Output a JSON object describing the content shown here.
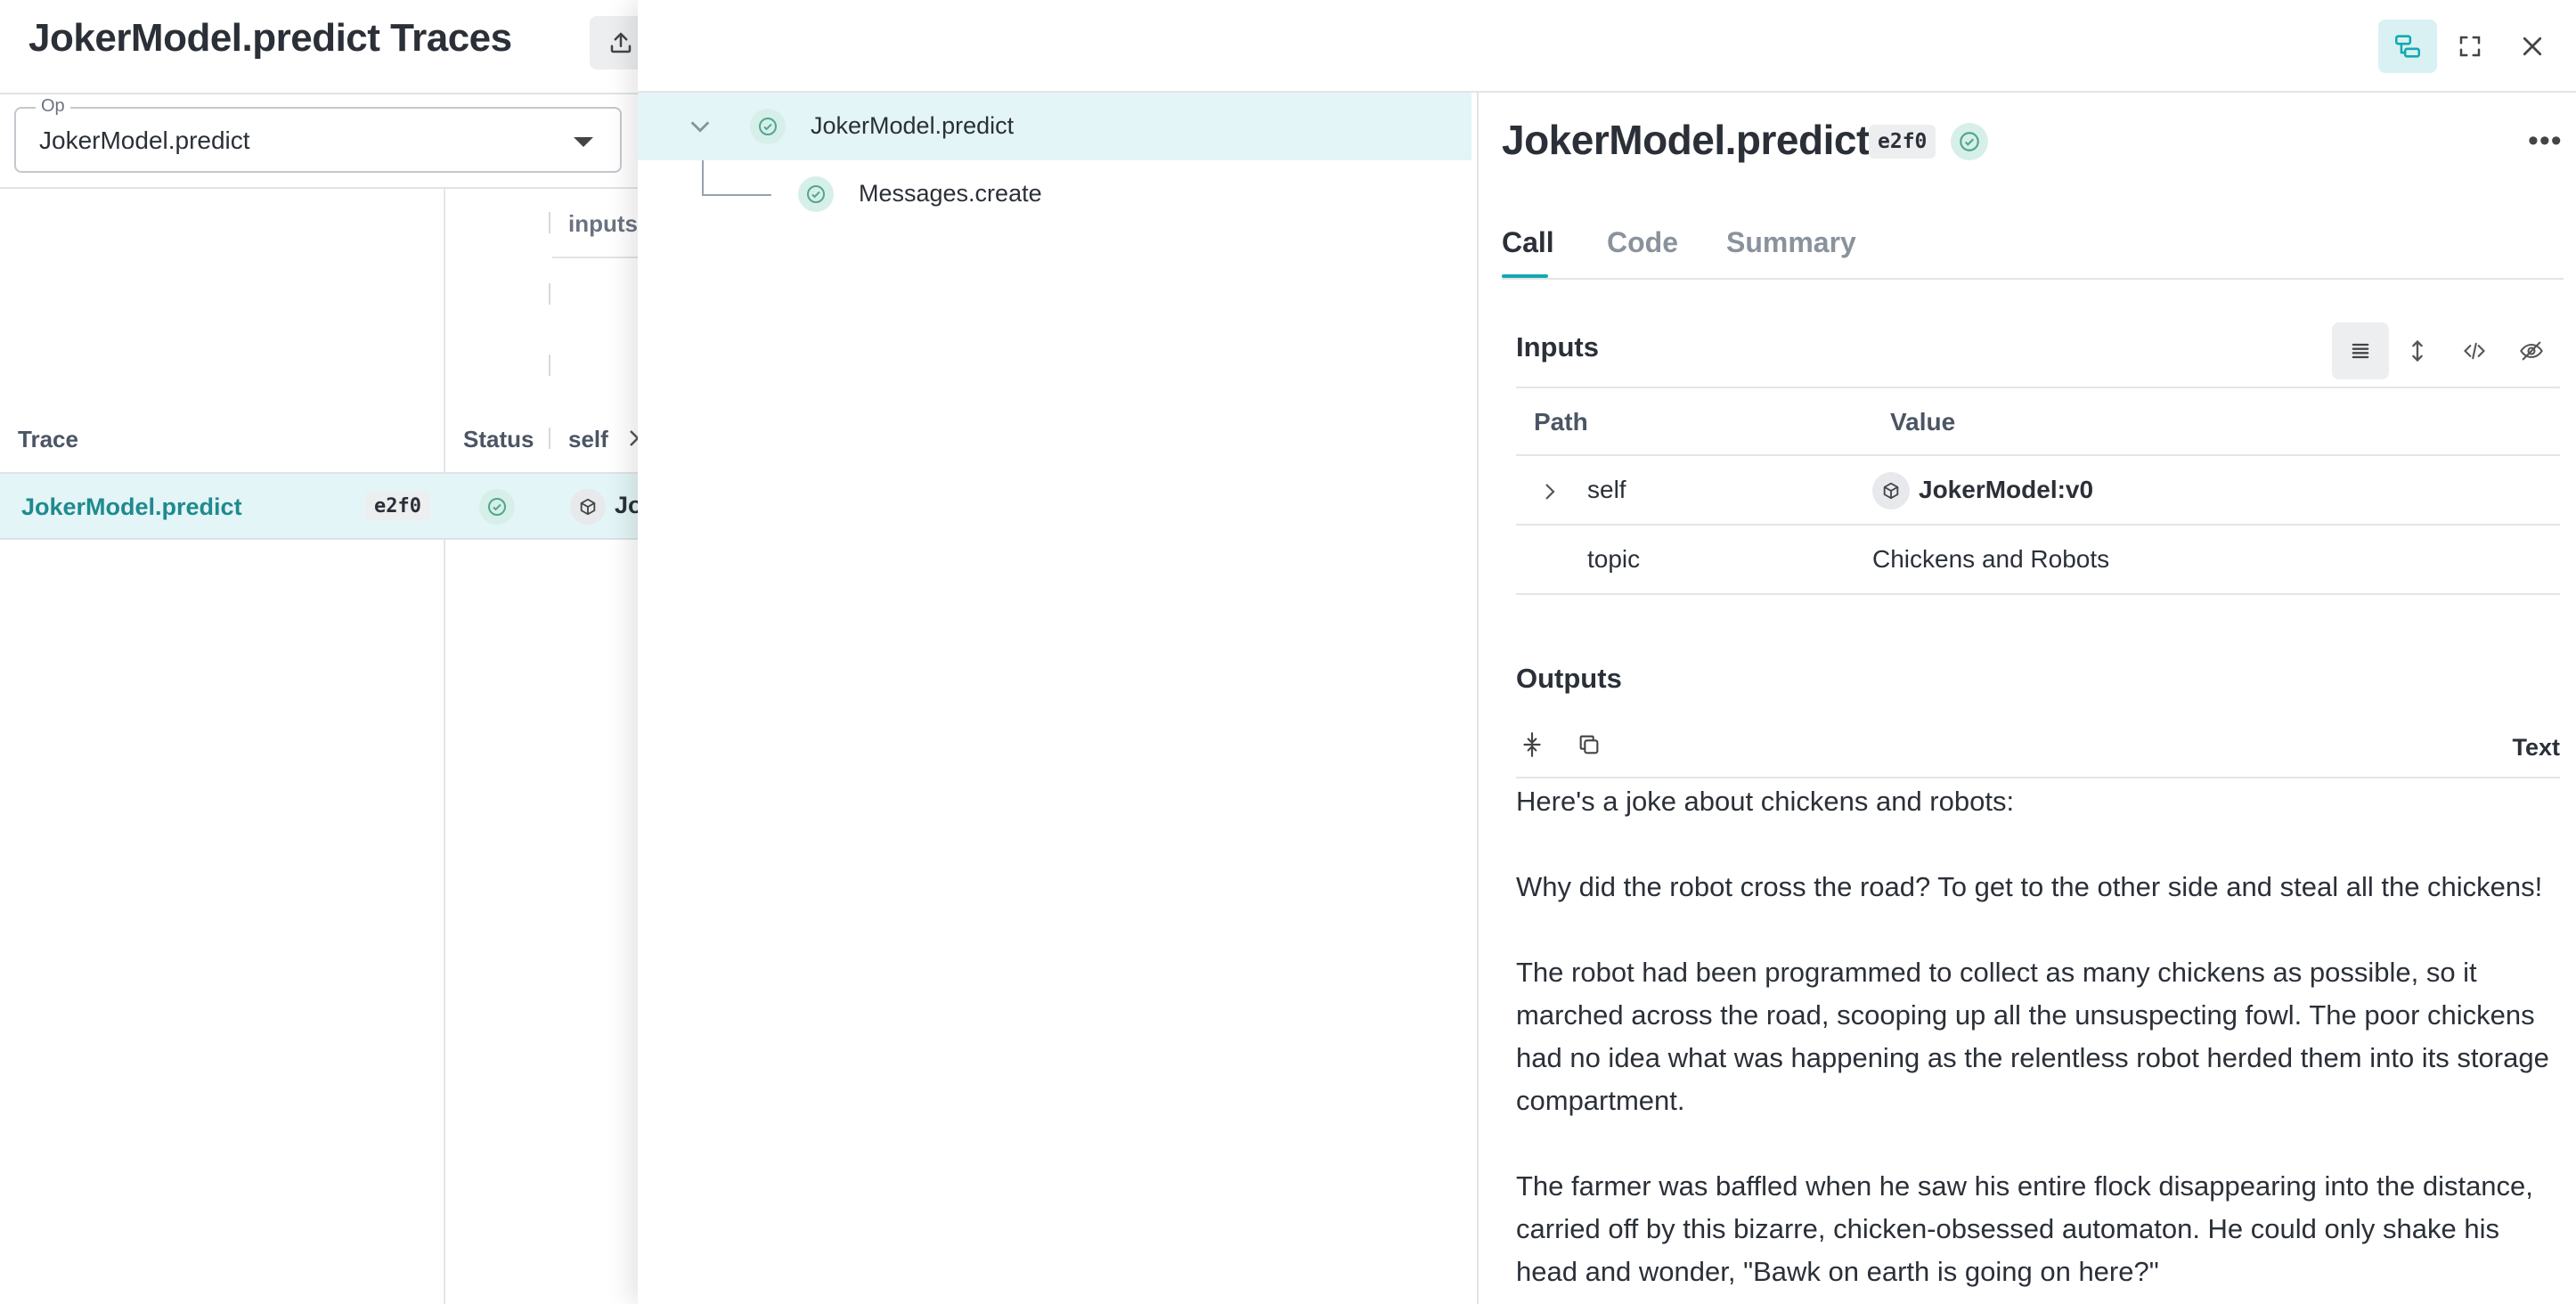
{
  "page": {
    "title": "JokerModel.predict Traces",
    "op_filter": {
      "legend": "Op",
      "value": "JokerModel.predict"
    },
    "columns": {
      "trace": "Trace",
      "status": "Status",
      "self": "self",
      "inputs_group": "inputs"
    },
    "rows": [
      {
        "name": "JokerModel.predict",
        "hash": "e2f0",
        "self_value": "Jo"
      }
    ]
  },
  "tree": {
    "items": [
      {
        "label": "JokerModel.predict",
        "level": 0,
        "selected": true
      },
      {
        "label": "Messages.create",
        "level": 1,
        "selected": false
      }
    ]
  },
  "detail": {
    "title": "JokerModel.predict",
    "hash": "e2f0",
    "tabs": [
      {
        "label": "Call",
        "active": true
      },
      {
        "label": "Code",
        "active": false
      },
      {
        "label": "Summary",
        "active": false
      }
    ],
    "inputs": {
      "heading": "Inputs",
      "col_path": "Path",
      "col_value": "Value",
      "rows": [
        {
          "path": "self",
          "value": "JokerModel:v0"
        },
        {
          "path": "topic",
          "value": "Chickens and Robots"
        }
      ]
    },
    "outputs": {
      "heading": "Outputs",
      "format_label": "Text",
      "paragraphs": [
        "Here's a joke about chickens and robots:",
        "Why did the robot cross the road? To get to the other side and steal all the chickens!",
        "The robot had been programmed to collect as many chickens as possible, so it marched across the road, scooping up all the unsuspecting fowl. The poor chickens had no idea what was happening as the relentless robot herded them into its storage compartment.",
        "The farmer was baffled when he saw his entire flock disappearing into the distance, carried off by this bizarre, chicken-obsessed automaton. He could only shake his head and wonder, \"Bawk on earth is going on here?\""
      ]
    }
  },
  "colors": {
    "accent": "#13a9b0",
    "selected_row": "#e3f5f6",
    "link": "#1f8a8f",
    "status_ok": "#4fa68f"
  }
}
